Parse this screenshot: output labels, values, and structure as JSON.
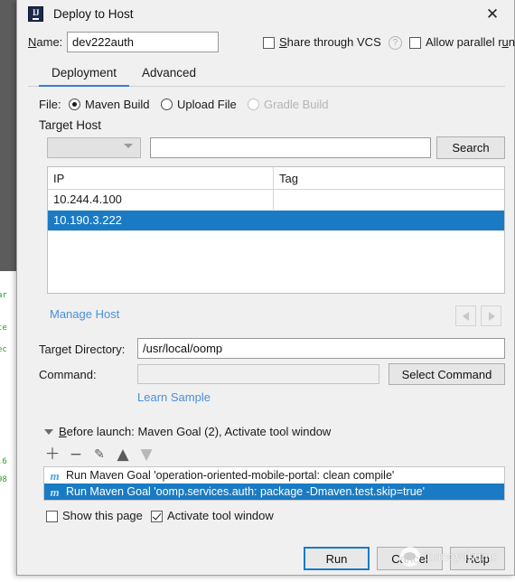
{
  "backdrop": {
    "console_lines": [
      "ar",
      "ce",
      "ec",
      ".6",
      "98"
    ]
  },
  "window": {
    "title": "Deploy to Host",
    "app_icon": "IJ",
    "close_icon": "✕"
  },
  "name_row": {
    "label": "Name:",
    "value": "dev222auth",
    "share_vcs_label": "Share through VCS",
    "share_vcs_checked": false,
    "help_icon": "?",
    "allow_parallel_label": "Allow parallel run",
    "allow_parallel_checked": false
  },
  "tabs": [
    {
      "label": "Deployment",
      "active": true
    },
    {
      "label": "Advanced",
      "active": false
    }
  ],
  "file_row": {
    "label": "File:",
    "options": [
      {
        "label": "Maven Build",
        "selected": true,
        "disabled": false
      },
      {
        "label": "Upload File",
        "selected": false,
        "disabled": false
      },
      {
        "label": "Gradle Build",
        "selected": false,
        "disabled": true
      }
    ]
  },
  "target_host": {
    "section_label": "Target Host",
    "combo_value": "",
    "search_value": "",
    "search_placeholder": "",
    "search_button": "Search",
    "columns": [
      "IP",
      "Tag"
    ],
    "rows": [
      {
        "ip": "10.244.4.100",
        "tag": "",
        "selected": false
      },
      {
        "ip": "10.190.3.222",
        "tag": "",
        "selected": true
      }
    ],
    "manage_host_link": "Manage Host",
    "page_prev_icon": "◀",
    "page_next_icon": "▶"
  },
  "deploy_fields": {
    "target_directory_label": "Target Directory:",
    "target_directory_value": "/usr/local/oomp",
    "command_label": "Command:",
    "command_value": "",
    "select_command_button": "Select Command",
    "learn_sample_link": "Learn Sample"
  },
  "before_launch": {
    "header": "Before launch: Maven Goal (2), Activate tool window",
    "toolbar": {
      "add_icon": "＋",
      "remove_icon": "−",
      "edit_icon": "✎",
      "up_icon": "▲",
      "down_icon": "▼"
    },
    "items": [
      {
        "icon": "m",
        "text": "Run Maven Goal 'operation-oriented-mobile-portal: clean compile'",
        "selected": false
      },
      {
        "icon": "m",
        "text": "Run Maven Goal 'oomp.services.auth: package -Dmaven.test.skip=true'",
        "selected": true
      }
    ],
    "show_page_label": "Show this page",
    "show_page_checked": false,
    "activate_tool_window_label": "Activate tool window",
    "activate_tool_window_checked": true
  },
  "footer": {
    "run_button": "Run",
    "cancel_button": "Cancel",
    "help_button": "Help"
  },
  "watermark": {
    "text": "toonoyakumo"
  },
  "colors": {
    "selection_blue": "#1a7bc4",
    "link_blue": "#4a90d9",
    "accent_border": "#3a7ecf",
    "dialog_bg": "#f0f0f0",
    "console_green": "#2aa02a"
  }
}
